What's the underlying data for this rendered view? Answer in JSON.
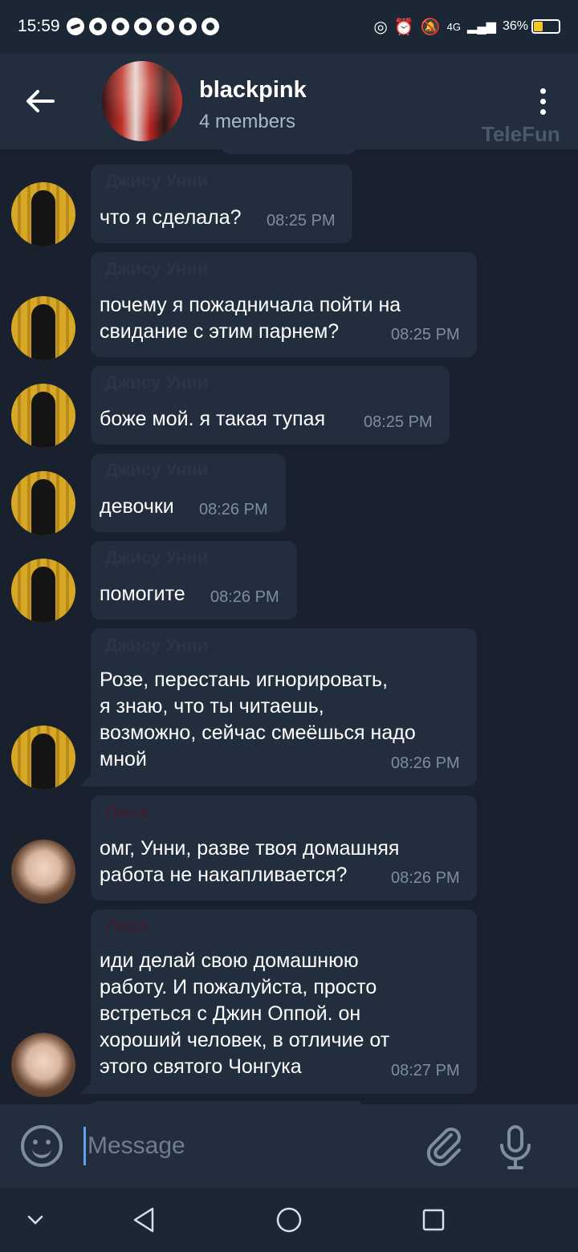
{
  "status_bar": {
    "time": "15:59",
    "network": "4G",
    "battery": "36%",
    "battery_level": 0.36
  },
  "header": {
    "title": "blackpink",
    "subtitle": "4 members",
    "watermark": "TeleFun"
  },
  "messages": [
    {
      "sender": "Джису Унни",
      "text": "что я сделала?",
      "time": "08:25 PM"
    },
    {
      "sender": "Джису Унни",
      "text": "почему я пожадничала пойти на\nсвидание с этим парнем?",
      "time": "08:25 PM"
    },
    {
      "sender": "Джису Унни",
      "text": "боже мой. я такая тупая",
      "time": "08:25 PM"
    },
    {
      "sender": "Джису Унни",
      "text": "девочки",
      "time": "08:26 PM"
    },
    {
      "sender": "Джису Унни",
      "text": "помогите",
      "time": "08:26 PM"
    },
    {
      "sender": "Джису Унни",
      "text": "Розе, перестань игнорировать,\nя знаю, что ты читаешь,\nвозможно, сейчас смеёшься надо\nмной",
      "time": "08:26 PM"
    },
    {
      "sender": "Лиса",
      "text": "омг, Унни, разве твоя домашняя\nработа не накапливается?",
      "time": "08:26 PM"
    },
    {
      "sender": "Лиса",
      "text": "иди делай свою домашнюю\nработу. И пожалуйста, просто\nвстреться с Джин Оппой. он\nхороший человек, в отличие от\nэтого святого Чонгука",
      "time": "08:27 PM"
    }
  ],
  "input": {
    "placeholder": "Message"
  },
  "colors": {
    "background": "#18212d",
    "bubble": "#222e3e",
    "accent": "#5ea2f0",
    "muted_text": "#7e8d9f"
  },
  "icons": [
    "back-arrow-icon",
    "more-vertical-icon",
    "emoji-icon",
    "paperclip-icon",
    "microphone-icon",
    "nav-down-icon",
    "nav-back-icon",
    "nav-home-icon",
    "nav-recents-icon"
  ]
}
